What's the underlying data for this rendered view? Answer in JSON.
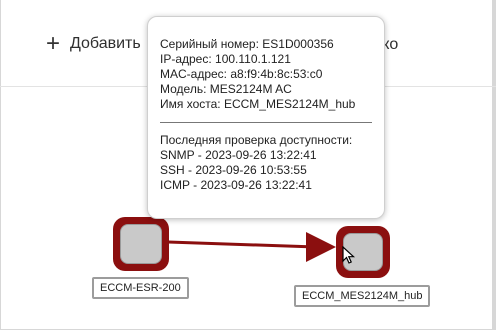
{
  "toolbar": {
    "add_label": "Добавить",
    "right_text": "лако"
  },
  "tooltip": {
    "serial": "Серийный номер: ES1D000356",
    "ip": "IP-адрес: 100.110.1.121",
    "mac": "MAC-адрес: a8:f9:4b:8c:53:c0",
    "model": "Модель: MES2124M AC",
    "hostname": "Имя хоста: ECCM_MES2124M_hub",
    "availability_title": "Последняя проверка доступности:",
    "snmp": "SNMP - 2023-09-26 13:22:41",
    "ssh": "SSH - 2023-09-26 10:53:55",
    "icmp": "ICMP - 2023-09-26 13:22:41"
  },
  "nodes": {
    "router_label": "ECCM-ESR-200",
    "switch_label": "ECCM_MES2124M_hub"
  },
  "colors": {
    "link": "#8b0f0f",
    "node_border": "#8b0f0f"
  }
}
